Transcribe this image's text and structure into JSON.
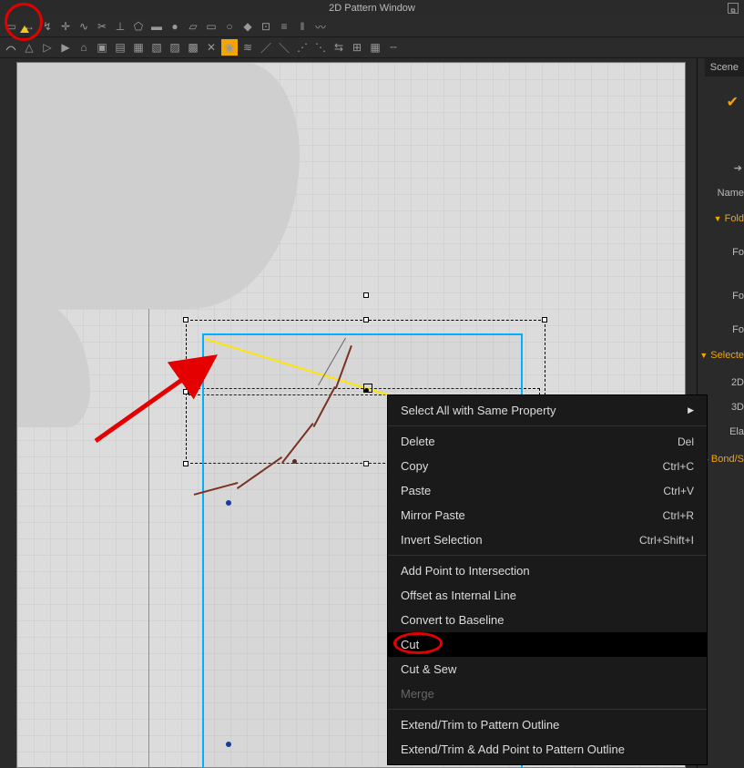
{
  "window": {
    "title": "2D Pattern Window"
  },
  "context_menu": {
    "items": [
      {
        "label": "Select All with Same Property",
        "shortcut": "",
        "submenu": true
      },
      {
        "label": "Delete",
        "shortcut": "Del"
      },
      {
        "label": "Copy",
        "shortcut": "Ctrl+C"
      },
      {
        "label": "Paste",
        "shortcut": "Ctrl+V"
      },
      {
        "label": "Mirror Paste",
        "shortcut": "Ctrl+R"
      },
      {
        "label": "Invert Selection",
        "shortcut": "Ctrl+Shift+I"
      },
      {
        "label": "Add Point to Intersection",
        "shortcut": ""
      },
      {
        "label": "Offset as Internal Line",
        "shortcut": ""
      },
      {
        "label": "Convert to Baseline",
        "shortcut": ""
      },
      {
        "label": "Cut",
        "shortcut": ""
      },
      {
        "label": "Cut & Sew",
        "shortcut": ""
      },
      {
        "label": "Merge",
        "shortcut": "",
        "disabled": true
      },
      {
        "label": "Extend/Trim to Pattern Outline",
        "shortcut": ""
      },
      {
        "label": "Extend/Trim & Add Point to Pattern Outline",
        "shortcut": ""
      }
    ]
  },
  "side": {
    "scene_tab": "Scene",
    "name_label": "Name",
    "fold_label": "Fold",
    "fo1": "Fo",
    "fo2": "Fo",
    "fo3": "Fo",
    "selected_label": "Selecte",
    "g2d": "2D",
    "g3d": "3D",
    "ela": "Ela",
    "bond": "Bond/S"
  }
}
